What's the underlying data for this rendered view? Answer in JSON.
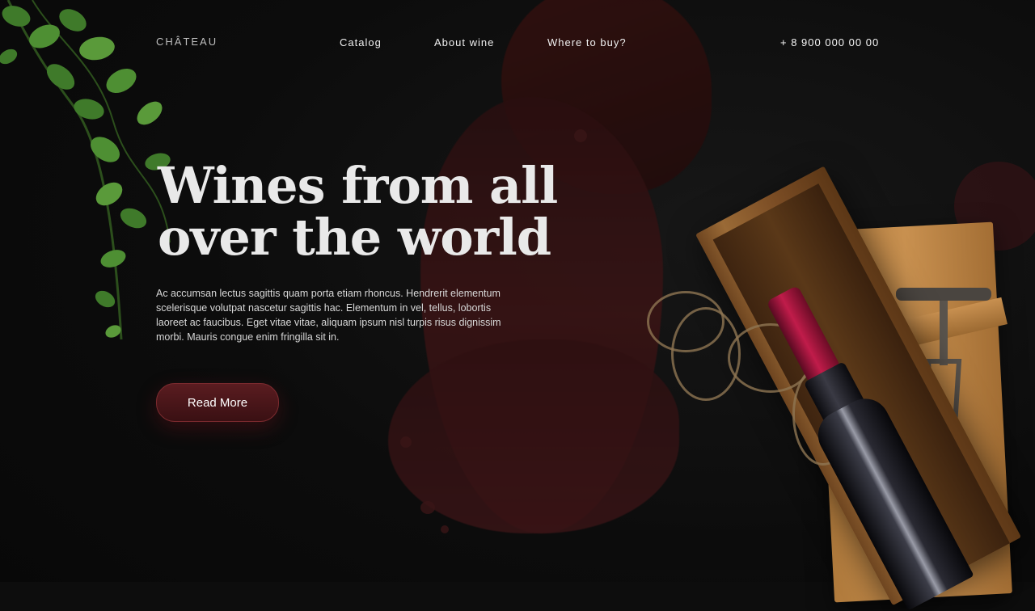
{
  "brand": {
    "logo": "CHÂTEAU"
  },
  "nav": {
    "items": [
      {
        "label": "Catalog"
      },
      {
        "label": "About wine"
      },
      {
        "label": "Where to buy?"
      }
    ],
    "phone": "+ 8 900 000 00 00"
  },
  "hero": {
    "title_line1": "Wines from all",
    "title_line2": "over the world",
    "description": "Ac accumsan lectus sagittis quam porta etiam rhoncus. Hendrerit elementum scelerisque volutpat nascetur sagittis hac. Elementum in vel, tellus, lobortis laoreet ac faucibus. Eget vitae vitae, aliquam ipsum nisl turpis risus dignissim morbi. Mauris congue enim fringilla sit in.",
    "cta_label": "Read More"
  },
  "colors": {
    "background": "#0d0d0d",
    "accent_wine": "#5a1c20",
    "cap_red": "#c01c4a",
    "wood": "#a36e34",
    "vine_green": "#3f7a2a"
  },
  "icons": [
    "vine-leaves",
    "wine-bottle",
    "wooden-crate",
    "corkscrew"
  ]
}
